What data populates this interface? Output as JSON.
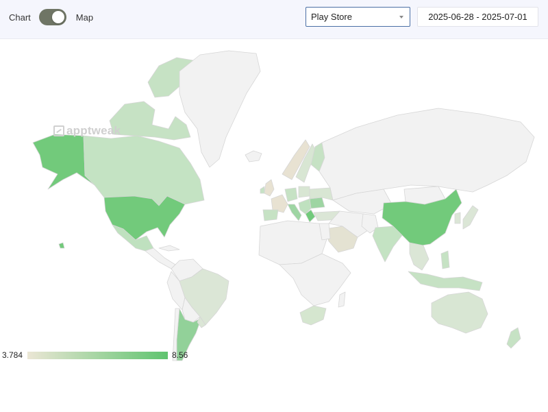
{
  "header": {
    "view_toggle": {
      "left_label": "Chart",
      "right_label": "Map",
      "selected": "Map"
    },
    "store_select": {
      "value": "Play Store"
    },
    "date_range": {
      "value": "2025-06-28 - 2025-07-01"
    }
  },
  "map": {
    "watermark": "apptweak",
    "legend": {
      "min": "3.784",
      "max": "8.56",
      "min_color": "#ebe6d5",
      "max_color": "#5fc46f"
    },
    "no_data_color": "#f2f2f2",
    "border_color": "#d6d6d6"
  }
}
